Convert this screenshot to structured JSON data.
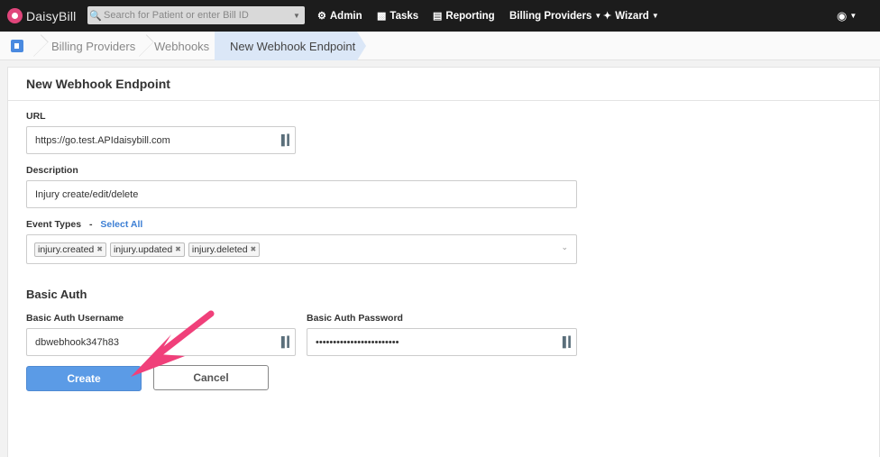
{
  "topnav": {
    "brand": "DaisyBill",
    "search_placeholder": "Search for Patient or enter Bill ID",
    "items": [
      {
        "label": "Admin",
        "icon": "gear-icon"
      },
      {
        "label": "Tasks",
        "icon": "clipboard-icon"
      },
      {
        "label": "Reporting",
        "icon": "bar-chart-icon"
      },
      {
        "label": "Billing Providers",
        "icon": "chevron-down-icon"
      },
      {
        "label": "Wizard",
        "icon": "wand-icon"
      }
    ],
    "user_icon": "user-circle-icon"
  },
  "breadcrumb": {
    "items": [
      "Billing Providers",
      "Webhooks"
    ],
    "active": "New Webhook Endpoint"
  },
  "form": {
    "title": "New Webhook Endpoint",
    "url_label": "URL",
    "url_value": "https://go.test.APIdaisybill.com",
    "description_label": "Description",
    "description_value": "Injury create/edit/delete",
    "event_types_label": "Event Types",
    "event_types_sep": "-",
    "select_all": "Select All",
    "event_tags": [
      "injury.created",
      "injury.updated",
      "injury.deleted"
    ],
    "basic_auth_title": "Basic Auth",
    "username_label": "Basic Auth Username",
    "username_value": "dbwebhook347h83",
    "password_label": "Basic Auth Password",
    "password_value": "••••••••••••••••••••••••",
    "create_button": "Create",
    "cancel_button": "Cancel"
  },
  "colors": {
    "accent": "#5b9be6",
    "nav_bg": "#1c1c1c",
    "annotation_arrow": "#f0407a"
  }
}
